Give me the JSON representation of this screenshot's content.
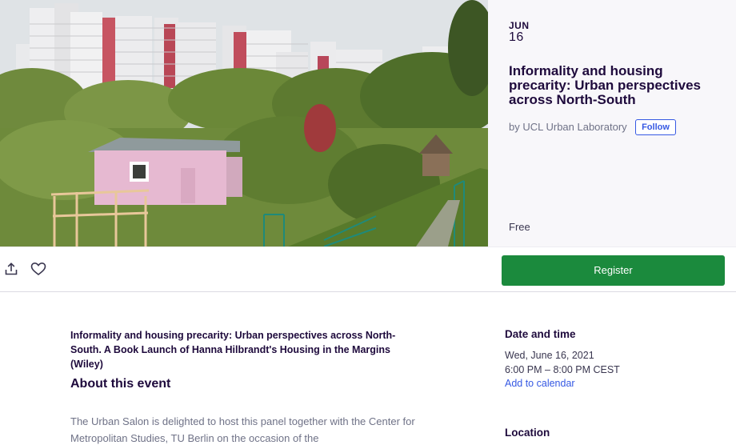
{
  "event": {
    "month": "JUN",
    "day": "16",
    "title": "Informality and housing precarity: Urban perspectives across North-South",
    "organizer": "by UCL Urban Laboratory",
    "follow_label": "Follow",
    "price": "Free"
  },
  "actions": {
    "share_icon": "share-icon",
    "like_icon": "heart-icon",
    "register_label": "Register"
  },
  "content": {
    "summary": "Informality and housing precarity: Urban perspectives across North-South. A Book Launch of Hanna Hilbrandt's Housing in the Margins (Wiley)",
    "about_heading": "About this event",
    "about_body": "The Urban Salon is delighted to host this panel together with the Center for Metropolitan Studies, TU Berlin on the occasion of the"
  },
  "sidebar": {
    "date_heading": "Date and time",
    "date": "Wed, June 16, 2021",
    "time": "6:00 PM – 8:00 PM CEST",
    "add_to_calendar": "Add to calendar",
    "location_heading": "Location"
  },
  "colors": {
    "brand_text": "#1e0a3c",
    "link_blue": "#3659e3",
    "register_green": "#1b8a3d",
    "panel_bg": "#f8f7fa"
  }
}
